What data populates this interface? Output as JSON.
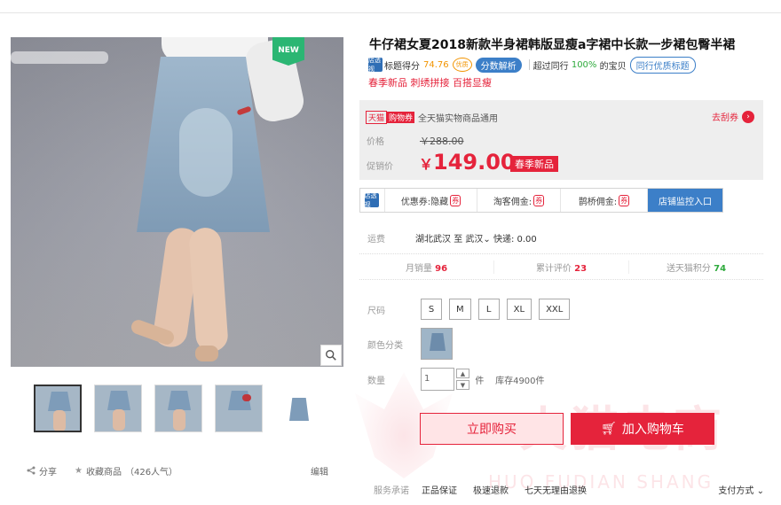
{
  "gallery": {
    "new_badge": "NEW",
    "thumb_count": 5
  },
  "share": {
    "share_label": "分享",
    "favorite_label": "收藏商品",
    "popularity": "（426人气）",
    "edit_label": "编辑"
  },
  "product": {
    "title": "牛仔裙女夏2018新款半身裙韩版显瘦a字裙中长款一步裙包臀半裙",
    "subtitle": "春季新品 刺绣拼接 百搭显瘦",
    "store_icon_label": "店透视",
    "title_score_label": "标题得分",
    "title_score": "74.76",
    "seal_label": "优质",
    "analysis_button": "分数解析",
    "exceed_prefix": "超过同行",
    "exceed_percent": "100%",
    "exceed_suffix": "的宝贝",
    "peer_title_button": "同行优质标题"
  },
  "price": {
    "tmall_tag": "天猫",
    "coupon_tag": "购物券",
    "coupon_text": "全天猫实物商品通用",
    "get_coupon": "去刮券",
    "price_label": "价格",
    "original_price": "￥288.00",
    "promo_label": "促销价",
    "currency": "￥",
    "promo_price": "149.00",
    "promo_tag": "春季新品"
  },
  "ext_bar": {
    "coupon_hidden": "优惠券:隐藏",
    "taoke": "淘客佣金:",
    "queqiao": "鹊桥佣金:",
    "monitor_button": "店铺监控入口"
  },
  "shipping": {
    "label": "运费",
    "from": "湖北武汉",
    "to_word": "至",
    "to_city": "武汉",
    "express": "快递: 0.00"
  },
  "stats": {
    "monthly_label": "月销量",
    "monthly": "96",
    "reviews_label": "累计评价",
    "reviews": "23",
    "points_label": "送天猫积分",
    "points": "74"
  },
  "options": {
    "size_label": "尺码",
    "sizes": [
      "S",
      "M",
      "L",
      "XL",
      "XXL"
    ],
    "color_label": "颜色分类",
    "qty_label": "数量",
    "qty_value": "1",
    "unit": "件",
    "stock": "库存4900件"
  },
  "buttons": {
    "buy_now": "立即购买",
    "add_cart": "加入购物车"
  },
  "watermark": {
    "text": "火猫电商",
    "pinyin": "HUO FUDIAN SHANG"
  },
  "service": {
    "label": "服务承诺",
    "items": [
      "正品保证",
      "极速退款",
      "七天无理由退换"
    ],
    "payment": "支付方式"
  },
  "colors": {
    "accent_red": "#e5233b",
    "accent_blue": "#3c7fc8",
    "green": "#2eaa3c"
  }
}
